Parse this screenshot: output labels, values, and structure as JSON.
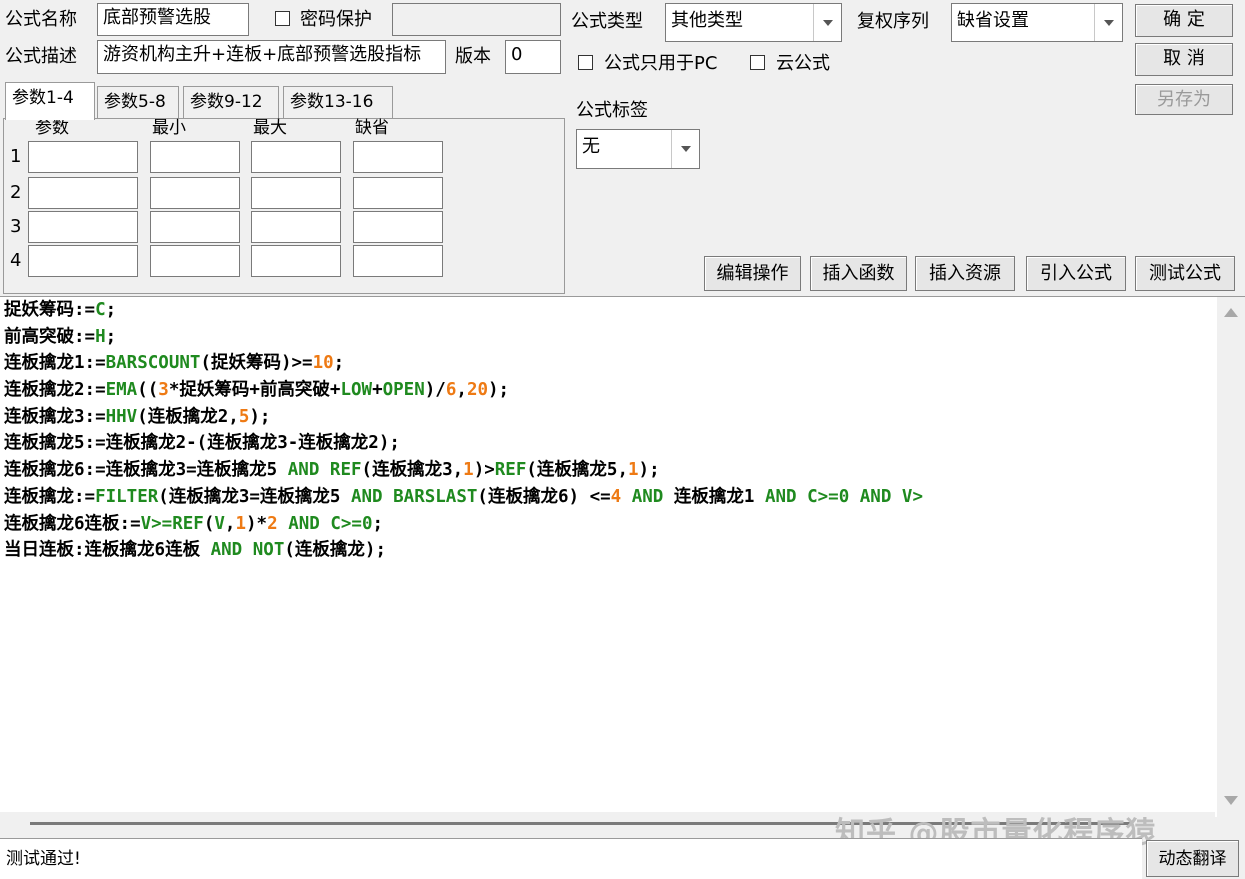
{
  "form": {
    "name_label": "公式名称",
    "name_value": "底部预警选股",
    "password_label": "密码保护",
    "password_value": "",
    "desc_label": "公式描述",
    "desc_value": "游资机构主升+连板+底部预警选股指标",
    "version_label": "版本",
    "version_value": "0",
    "type_label": "公式类型",
    "type_value": "其他类型",
    "rights_label": "复权序列",
    "rights_value": "缺省设置",
    "pc_only_label": "公式只用于PC",
    "cloud_label": "云公式",
    "tag_label": "公式标签",
    "tag_value": "无"
  },
  "buttons": {
    "ok": "确 定",
    "cancel": "取 消",
    "save_as": "另存为",
    "edit_ops": "编辑操作",
    "insert_func": "插入函数",
    "insert_res": "插入资源",
    "import_formula": "引入公式",
    "test_formula": "测试公式",
    "dynamic_translate": "动态翻译"
  },
  "params": {
    "tabs": [
      "参数1-4",
      "参数5-8",
      "参数9-12",
      "参数13-16"
    ],
    "headers": [
      "参数",
      "最小",
      "最大",
      "缺省"
    ],
    "rows": [
      "1",
      "2",
      "3",
      "4"
    ]
  },
  "code_lines": [
    [
      [
        "捉妖筹码:=",
        "p"
      ],
      [
        "C",
        "f"
      ],
      [
        ";",
        "p"
      ]
    ],
    [
      [
        "前高突破:=",
        "p"
      ],
      [
        "H",
        "f"
      ],
      [
        ";",
        "p"
      ]
    ],
    [
      [
        "连板擒龙1:=",
        "p"
      ],
      [
        "BARSCOUNT",
        "f"
      ],
      [
        "(捉妖筹码)>=",
        "p"
      ],
      [
        "10",
        "n"
      ],
      [
        ";",
        "p"
      ]
    ],
    [
      [
        "连板擒龙2:=",
        "p"
      ],
      [
        "EMA",
        "f"
      ],
      [
        "((",
        "p"
      ],
      [
        "3",
        "n"
      ],
      [
        "*捉妖筹码+前高突破+",
        "p"
      ],
      [
        "LOW",
        "f"
      ],
      [
        "+",
        "p"
      ],
      [
        "OPEN",
        "f"
      ],
      [
        ")/",
        "p"
      ],
      [
        "6",
        "n"
      ],
      [
        ",",
        "p"
      ],
      [
        "20",
        "n"
      ],
      [
        ");",
        "p"
      ]
    ],
    [
      [
        "连板擒龙3:=",
        "p"
      ],
      [
        "HHV",
        "f"
      ],
      [
        "(连板擒龙2,",
        "p"
      ],
      [
        "5",
        "n"
      ],
      [
        ");",
        "p"
      ]
    ],
    [
      [
        "连板擒龙5:=连板擒龙2-(连板擒龙3-连板擒龙2);",
        "p"
      ]
    ],
    [
      [
        "连板擒龙6:=连板擒龙3=连板擒龙5 ",
        "p"
      ],
      [
        "AND REF",
        "f"
      ],
      [
        "(连板擒龙3,",
        "p"
      ],
      [
        "1",
        "n"
      ],
      [
        ")>",
        "p"
      ],
      [
        "REF",
        "f"
      ],
      [
        "(连板擒龙5,",
        "p"
      ],
      [
        "1",
        "n"
      ],
      [
        ");",
        "p"
      ]
    ],
    [
      [
        "连板擒龙:=",
        "p"
      ],
      [
        "FILTER",
        "f"
      ],
      [
        "(连板擒龙3=连板擒龙5 ",
        "p"
      ],
      [
        "AND BARSLAST",
        "f"
      ],
      [
        "(连板擒龙6) <=",
        "p"
      ],
      [
        "4",
        "n"
      ],
      [
        " ",
        "p"
      ],
      [
        "AND",
        "f"
      ],
      [
        " 连板擒龙1 ",
        "p"
      ],
      [
        "AND C>=0 AND V>",
        "f"
      ]
    ],
    [
      [
        "连板擒龙6连板:=",
        "p"
      ],
      [
        "V>=REF",
        "f"
      ],
      [
        "(",
        "p"
      ],
      [
        "V",
        "f"
      ],
      [
        ",",
        "p"
      ],
      [
        "1",
        "n"
      ],
      [
        ")*",
        "p"
      ],
      [
        "2",
        "n"
      ],
      [
        " ",
        "p"
      ],
      [
        "AND C>=0",
        "f"
      ],
      [
        ";",
        "p"
      ]
    ],
    [
      [
        "当日连板:连板擒龙6连板 ",
        "p"
      ],
      [
        "AND NOT",
        "f"
      ],
      [
        "(连板擒龙);",
        "p"
      ]
    ]
  ],
  "status_text": "测试通过!",
  "watermark": "知乎 @股市量化程序猿"
}
